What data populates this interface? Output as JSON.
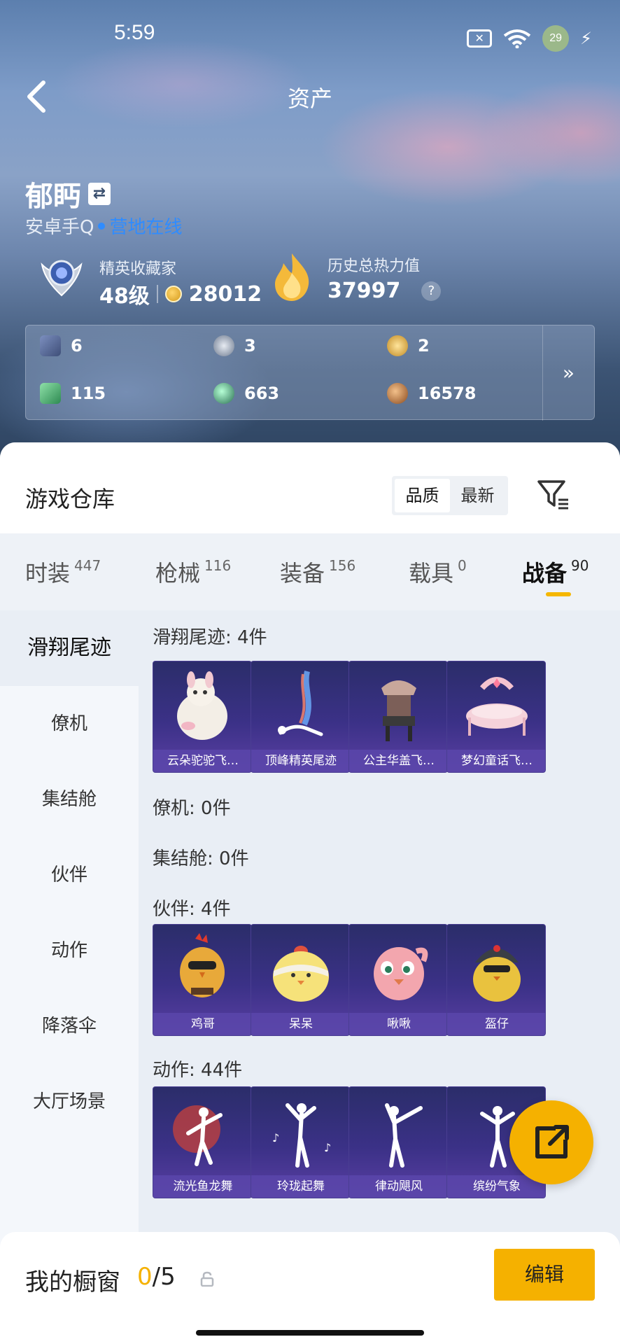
{
  "status_bar": {
    "time": "5:59",
    "battery": "29"
  },
  "header": {
    "title": "资产"
  },
  "player": {
    "name": "郁眄",
    "platform": "安卓手Q",
    "online_status": "营地在线",
    "collector_title": "精英收藏家",
    "collector_level": "48级",
    "collector_points": "28012",
    "heat_label": "历史总热力值",
    "heat_value": "37997",
    "help": "?"
  },
  "currencies": [
    {
      "icon": "card-ticket-icon",
      "value": "6",
      "color": "#5c6f9a"
    },
    {
      "icon": "silver-coin-icon",
      "value": "3",
      "color": "#8d9bb0"
    },
    {
      "icon": "gold-coin-icon",
      "value": "2",
      "color": "#d4a53a"
    },
    {
      "icon": "green-voucher-icon",
      "value": "115",
      "color": "#4caf70"
    },
    {
      "icon": "green-orb-icon",
      "value": "663",
      "color": "#3f8f6a"
    },
    {
      "icon": "bronze-orb-icon",
      "value": "16578",
      "color": "#b06c38"
    }
  ],
  "currency_more": "»",
  "warehouse": {
    "title": "游戏仓库",
    "sort_quality": "品质",
    "sort_newest": "最新"
  },
  "tabs": [
    {
      "label": "时装",
      "count": "447"
    },
    {
      "label": "枪械",
      "count": "116"
    },
    {
      "label": "装备",
      "count": "156"
    },
    {
      "label": "载具",
      "count": "0"
    },
    {
      "label": "战备",
      "count": "90"
    }
  ],
  "side_nav": [
    "滑翔尾迹",
    "僚机",
    "集结舱",
    "伙伴",
    "动作",
    "降落伞",
    "大厅场景"
  ],
  "sections": {
    "glide": {
      "title": "滑翔尾迹: 4件",
      "items": [
        "云朵驼驼飞…",
        "顶峰精英尾迹",
        "公主华盖飞…",
        "梦幻童话飞…"
      ]
    },
    "wingman": {
      "title": "僚机: 0件"
    },
    "pod": {
      "title": "集结舱: 0件"
    },
    "partner": {
      "title": "伙伴: 4件",
      "items": [
        "鸡哥",
        "呆呆",
        "啾啾",
        "盔仔"
      ]
    },
    "emote": {
      "title": "动作: 44件",
      "items": [
        "流光鱼龙舞",
        "玲珑起舞",
        "律动飓风",
        "缤纷气象"
      ]
    }
  },
  "showcase": {
    "label": "我的橱窗",
    "current": "0",
    "total": "/5"
  },
  "edit_label": "编辑",
  "accent": "#f5b100"
}
